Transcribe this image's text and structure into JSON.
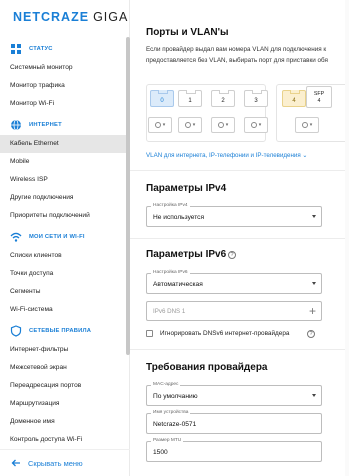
{
  "brand": {
    "part1": "NETCRAZE",
    "part2": "GIGA"
  },
  "sidebar": {
    "sections": [
      {
        "title": "СТАТУС",
        "icon": "dashboard-icon",
        "items": [
          "Системный монитор",
          "Монитор трафика",
          "Монитор Wi-Fi"
        ]
      },
      {
        "title": "ИНТЕРНЕТ",
        "icon": "globe-icon",
        "items": [
          "Кабель Ethernet",
          "Mobile",
          "Wireless ISP",
          "Другие подключения",
          "Приоритеты подключений"
        ]
      },
      {
        "title": "МОИ СЕТИ И WI-FI",
        "icon": "wifi-icon",
        "items": [
          "Списки клиентов",
          "Точки доступа",
          "Сегменты",
          "Wi-Fi-система"
        ]
      },
      {
        "title": "СЕТЕВЫЕ ПРАВИЛА",
        "icon": "shield-icon",
        "items": [
          "Интернет-фильтры",
          "Межсетевой экран",
          "Переадресация портов",
          "Маршрутизация",
          "Доменное имя",
          "Контроль доступа Wi-Fi"
        ]
      }
    ],
    "active_item": "Кабель Ethernet",
    "footer": {
      "label": "Скрывать меню",
      "icon": "arrow-left-icon"
    }
  },
  "ports_section": {
    "title": "Порты и VLAN'ы",
    "description_line1": "Если провайдер выдал вам номера VLAN для подключения к",
    "description_line2": "предоставляется без VLAN, выбирать порт для приставки обя",
    "ports": [
      "0",
      "1",
      "2",
      "3",
      "4"
    ],
    "sfp_label": "SFP",
    "sfp_number": "4",
    "link": "VLAN для интернета, IP-телефонии и IP-телевидения"
  },
  "ipv4": {
    "title": "Параметры IPv4",
    "setting_label": "Настройка IPv4",
    "setting_value": "Не используется"
  },
  "ipv6": {
    "title": "Параметры IPv6",
    "setting_label": "Настройка IPv6",
    "setting_value": "Автоматическая",
    "dns_placeholder": "IPv6 DNS 1",
    "ignore_dns_label": "Игнорировать DNSv6 интернет-провайдера"
  },
  "provider": {
    "title": "Требования провайдера",
    "mac_label": "MAC-адрес",
    "mac_value": "По умолчанию",
    "device_name_label": "Имя устройства",
    "device_name_value": "Netcraze-0571",
    "mtu_label": "Размер MTU",
    "mtu_value": "1500"
  },
  "colors": {
    "accent": "#1a7fd6",
    "port_active": "#dcebfa",
    "port_sfp": "#fbefcf"
  }
}
